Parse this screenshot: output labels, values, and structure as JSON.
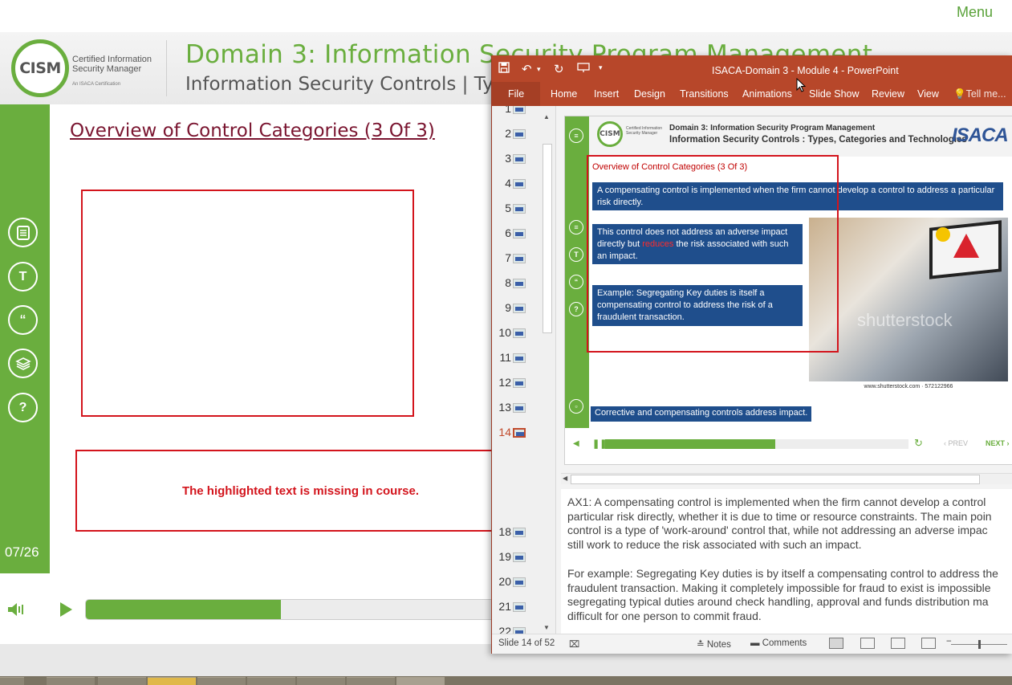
{
  "top_bar": {
    "menu_label": "Menu"
  },
  "course": {
    "logo_text": "CISM",
    "logo_caption_line1": "Certified Information",
    "logo_caption_line2": "Security Manager",
    "logo_caption_small": "An ISACA Certification",
    "title": "Domain 3: Information Security Program Management",
    "subtitle": "Information Security Controls | Types",
    "slide_heading": "Overview of Control Categories (3 Of 3)",
    "missing_note": "The highlighted text is missing in course.",
    "page_counter": "07/26",
    "progress_fraction": 0.47,
    "rail_icons": [
      "notes-icon",
      "transcript-icon",
      "quote-icon",
      "layers-icon",
      "help-icon"
    ]
  },
  "ppt": {
    "doc_title": "ISACA-Domain 3 - Module 4 - PowerPoint",
    "ribbon_tabs": [
      "File",
      "Home",
      "Insert",
      "Design",
      "Transitions",
      "Animations",
      "Slide Show",
      "Review",
      "View",
      "Tell me..."
    ],
    "thumbnails": [
      "1",
      "2",
      "3",
      "4",
      "5",
      "6",
      "7",
      "8",
      "9",
      "10",
      "11",
      "12",
      "13",
      "14",
      "18",
      "19",
      "20",
      "21",
      "22"
    ],
    "active_thumbnail": "14",
    "slide": {
      "logo_text": "CISM",
      "logo_caption": "Certified Information Security Manager",
      "title_line1": "Domain 3: Information Security Program Management",
      "title_line2": "Information Security Controls  : Types, Categories and Technologies",
      "brand": "ISACA",
      "heading": "Overview of Control Categories (3 Of 3)",
      "box1": "A compensating control is implemented when the firm cannot develop a control to address a particular risk directly.",
      "box2_pre": "This control does not address an adverse impact directly but ",
      "box2_highlight": "reduces",
      "box2_post": " the risk associated with such an impact.",
      "box3": "Example: Segregating Key duties is itself a compensating control to address the risk of a fraudulent transaction.",
      "photo_watermark": "shutterstock",
      "photo_credit": "www.shutterstock.com · 572122966",
      "footer_note": "Corrective and compensating controls address impact.",
      "progress_fraction": 0.56,
      "prev_label": "‹ PREV",
      "next_label": "NEXT ›"
    },
    "notes": [
      "AX1: A compensating control is implemented when the firm cannot develop a control",
      "particular risk directly, whether it is due to time or resource constraints. The main poin",
      "control is a type of 'work-around' control that, while not addressing an adverse impac",
      "still work to reduce the risk associated with such an impact.",
      "For example: Segregating Key duties is by itself a compensating control to address the",
      "fraudulent transaction. Making it completely impossible for fraud to exist is impossible",
      "segregating typical duties around check handling, approval and funds distribution ma",
      "difficult for one person to commit fraud."
    ],
    "status": {
      "slide_info": "Slide 14 of 52",
      "notes_label": "Notes",
      "comments_label": "Comments"
    }
  },
  "colors": {
    "accent_green": "#6aae3e",
    "ppt_red": "#b7472a",
    "highlight_red": "#d3141c",
    "slide_blue": "#1f4e8c"
  }
}
